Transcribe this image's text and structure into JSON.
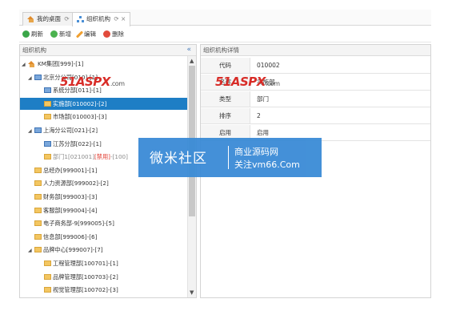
{
  "tabs": [
    {
      "label": "我的桌面",
      "suffix": "⟳"
    },
    {
      "label": "组织机构",
      "suffix": "⟳ ×"
    }
  ],
  "toolbar": {
    "refresh": "刷新",
    "add": "新增",
    "edit": "编辑",
    "delete": "删除"
  },
  "left_panel": {
    "title": "组织机构",
    "collapse": "«",
    "tree": [
      {
        "toggle": "◢",
        "icon": "home",
        "text": "KM集团[999]-[1]"
      },
      {
        "toggle": "◢",
        "icon": "unit",
        "text": "北京分公司[010]-[1]"
      },
      {
        "toggle": "",
        "icon": "unit",
        "text": "系统分部[011]-[1]"
      },
      {
        "toggle": "",
        "icon": "folder",
        "text": "实施部[010002]-[2]",
        "selected": true
      },
      {
        "toggle": "",
        "icon": "folder",
        "text": "市场部[010003]-[3]"
      },
      {
        "toggle": "◢",
        "icon": "unit",
        "text": "上海分公司[021]-[2]"
      },
      {
        "toggle": "",
        "icon": "unit",
        "text": "江苏分部[022]-[1]"
      },
      {
        "toggle": "",
        "icon": "folder",
        "text": "部门1[021001]",
        "red": "[禁用]",
        "tail": "-[100]"
      },
      {
        "toggle": "",
        "icon": "folder",
        "text": "总经办[999001]-[1]"
      },
      {
        "toggle": "",
        "icon": "folder",
        "text": "人力资源部[999002]-[2]"
      },
      {
        "toggle": "",
        "icon": "folder",
        "text": "财务部[999003]-[3]"
      },
      {
        "toggle": "",
        "icon": "folder",
        "text": "客服部[999004]-[4]"
      },
      {
        "toggle": "",
        "icon": "folder",
        "text": "电子商务部-9[999005]-[5]"
      },
      {
        "toggle": "",
        "icon": "folder",
        "text": "信息部[999006]-[6]"
      },
      {
        "toggle": "◢",
        "icon": "folder",
        "text": "品牌中心[999007]-[7]"
      },
      {
        "toggle": "",
        "icon": "folder",
        "text": "工程管理部[100701]-[1]"
      },
      {
        "toggle": "",
        "icon": "folder",
        "text": "品牌管理部[100703]-[2]"
      },
      {
        "toggle": "",
        "icon": "folder",
        "text": "视觉管理部[100702]-[3]"
      }
    ]
  },
  "right_panel": {
    "title": "组织机构详情",
    "rows": [
      {
        "label": "代码",
        "value": "010002"
      },
      {
        "label": "名称",
        "value": "实施部"
      },
      {
        "label": "类型",
        "value": "部门"
      },
      {
        "label": "排序",
        "value": "2"
      },
      {
        "label": "启用",
        "value": "启用"
      }
    ]
  },
  "watermark_51aspx": {
    "brand": "51ASPX",
    "suffix": ".com"
  },
  "banner": {
    "title": "微米社区",
    "line1": "商业源码网",
    "line2": "关注vm66.Com"
  },
  "colors": {
    "selected_bg": "#1e7ec5",
    "banner_bg": "#3a8bd6",
    "disabled_red": "#e23b2f"
  }
}
